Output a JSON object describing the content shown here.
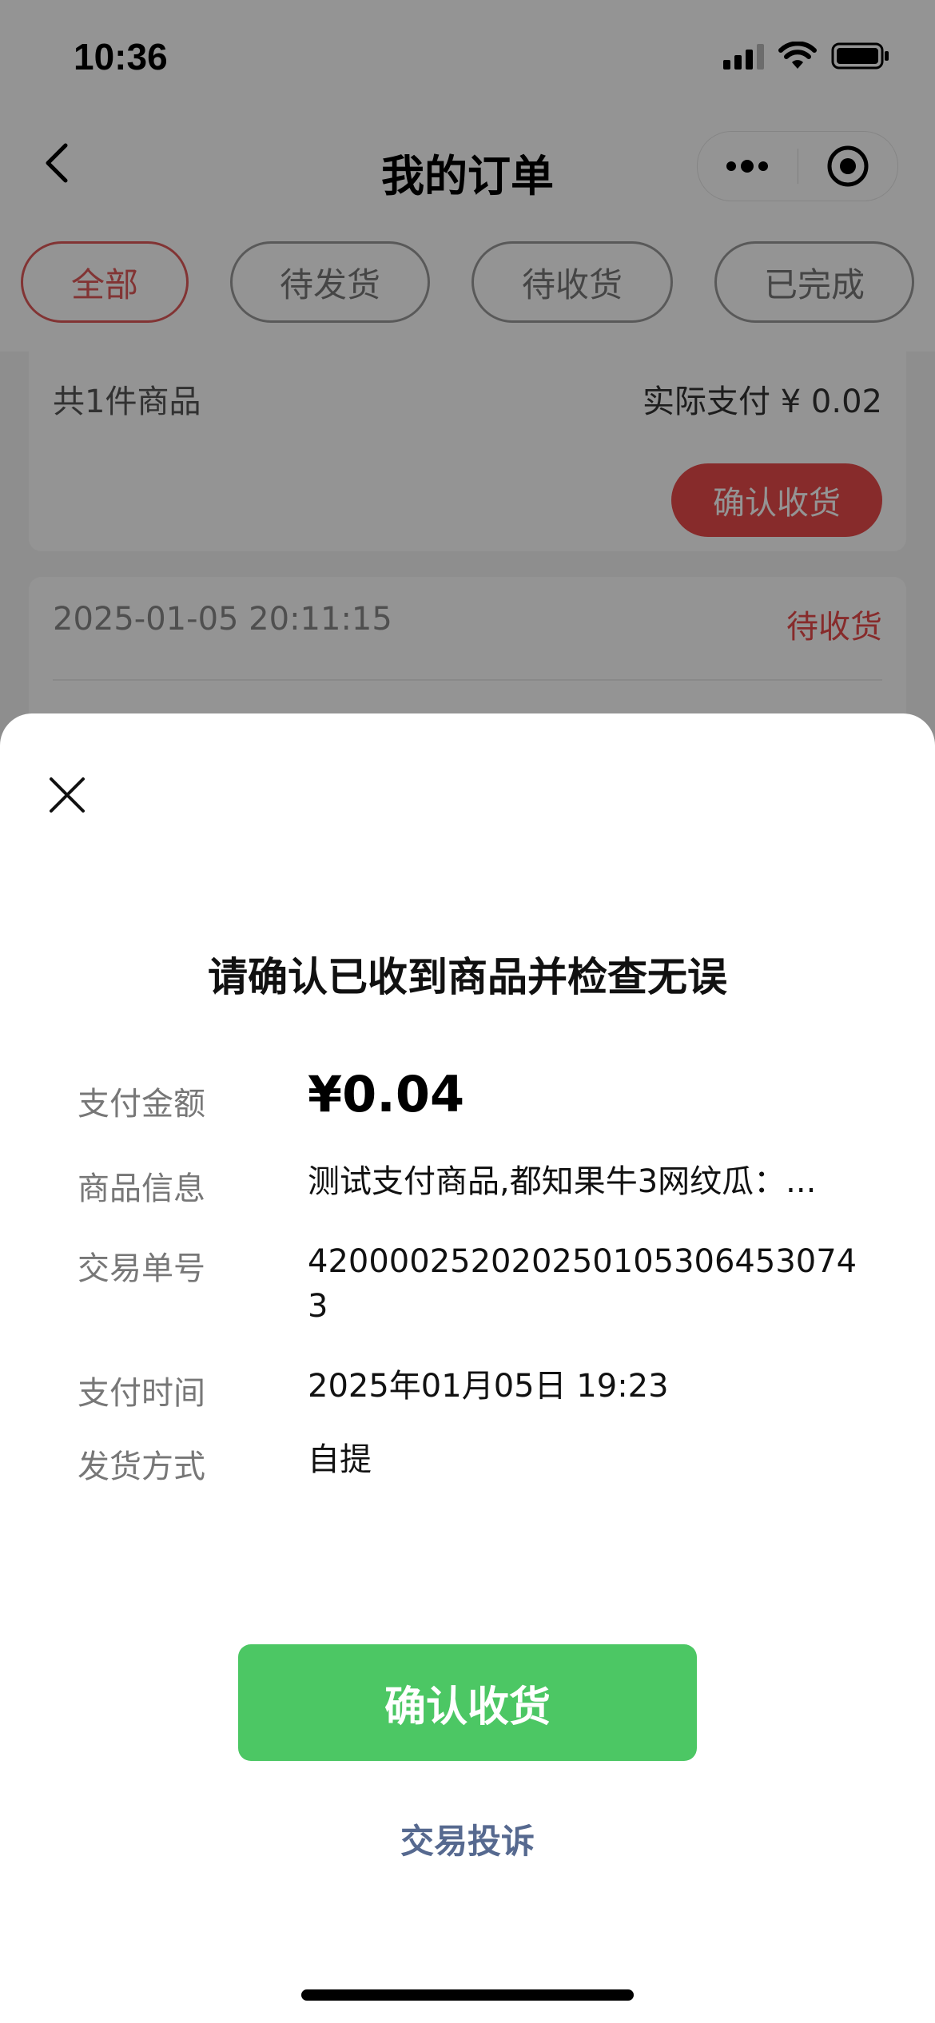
{
  "status_bar": {
    "time": "10:36",
    "icons": [
      "signal-icon",
      "wifi-icon",
      "battery-icon"
    ]
  },
  "nav": {
    "title": "我的订单",
    "back_icon": "chevron-left-icon",
    "more_icon": "more-dots-icon",
    "close_icon": "target-icon"
  },
  "tabs": [
    {
      "label": "全部",
      "active": true
    },
    {
      "label": "待发货",
      "active": false
    },
    {
      "label": "待收货",
      "active": false
    },
    {
      "label": "已完成",
      "active": false
    }
  ],
  "order_card_1": {
    "item_count": "共1件商品",
    "paid": "实际支付 ¥ 0.02",
    "confirm_label": "确认收货"
  },
  "order_card_2": {
    "time": "2025-01-05 20:11:15",
    "status": "待收货"
  },
  "modal": {
    "close_icon": "close-icon",
    "title": "请确认已收到商品并检查无误",
    "rows": [
      {
        "label": "支付金额",
        "value": "¥0.04"
      },
      {
        "label": "商品信息",
        "value": "测试支付商品,都知果牛3网纹瓜：..."
      },
      {
        "label": "交易单号",
        "value": "4200002520202501053064530743"
      },
      {
        "label": "支付时间",
        "value": "2025年01月05日 19:23"
      },
      {
        "label": "发货方式",
        "value": "自提"
      }
    ],
    "confirm_label": "确认收货",
    "complaint_label": "交易投诉"
  },
  "colors": {
    "accent_red": "#e84a4a",
    "confirm_green": "#4cc764",
    "link_blue": "#56698f"
  }
}
